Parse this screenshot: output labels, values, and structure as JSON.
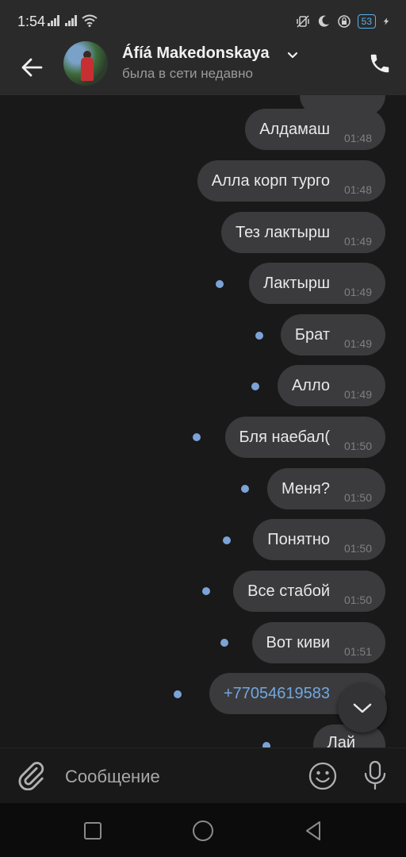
{
  "status_bar": {
    "time": "1:54",
    "battery": "53"
  },
  "header": {
    "contact_name": "Áfíá Makedonskaya",
    "status": "была в сети недавно"
  },
  "messages": [
    {
      "text": "Алдамаш",
      "time": "01:48",
      "unread": false,
      "is_link": false
    },
    {
      "text": "Алла корп турго",
      "time": "01:48",
      "unread": false,
      "is_link": false
    },
    {
      "text": "Тез лактырш",
      "time": "01:49",
      "unread": false,
      "is_link": false
    },
    {
      "text": "Лактырш",
      "time": "01:49",
      "unread": true,
      "is_link": false
    },
    {
      "text": "Брат",
      "time": "01:49",
      "unread": true,
      "is_link": false
    },
    {
      "text": "Алло",
      "time": "01:49",
      "unread": true,
      "is_link": false
    },
    {
      "text": "Бля наебал(",
      "time": "01:50",
      "unread": true,
      "is_link": false
    },
    {
      "text": "Меня?",
      "time": "01:50",
      "unread": true,
      "is_link": false
    },
    {
      "text": "Понятно",
      "time": "01:50",
      "unread": true,
      "is_link": false
    },
    {
      "text": "Все стабой",
      "time": "01:50",
      "unread": true,
      "is_link": false
    },
    {
      "text": "Вот киви",
      "time": "01:51",
      "unread": true,
      "is_link": false
    },
    {
      "text": "+77054619583",
      "time": "",
      "unread": true,
      "is_link": true
    },
    {
      "text": "Лай",
      "time": "",
      "unread": true,
      "is_link": false
    }
  ],
  "composer": {
    "placeholder": "Сообщение"
  },
  "colors": {
    "accent": "#7ba3d6",
    "link": "#71a7e0",
    "bubble": "#3b3b3d",
    "background": "#19191a"
  },
  "icons": [
    "back-arrow-icon",
    "chevron-down-icon",
    "phone-icon",
    "attach-icon",
    "emoji-icon",
    "mic-icon",
    "scroll-down-icon",
    "nav-square-icon",
    "nav-circle-icon",
    "nav-back-icon"
  ]
}
